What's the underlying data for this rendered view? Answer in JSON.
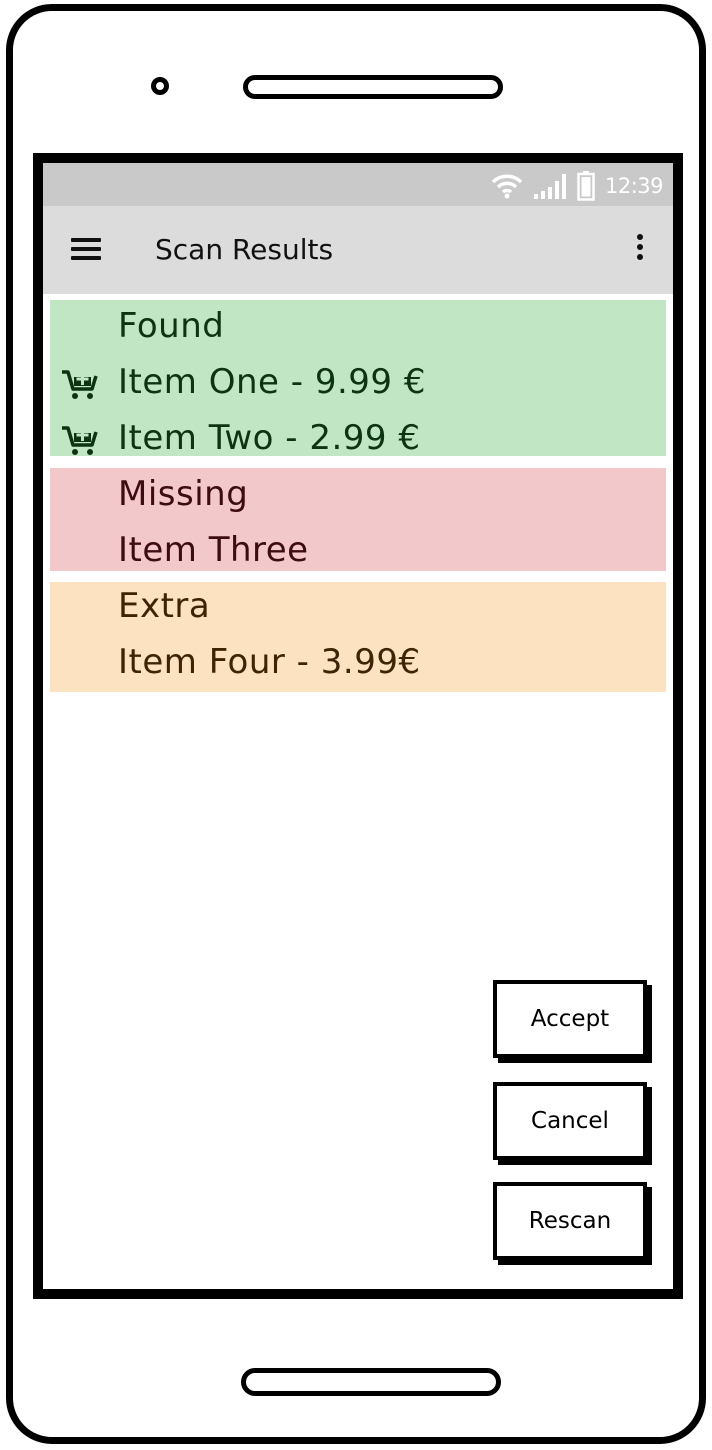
{
  "status_bar": {
    "time": "12:39",
    "icons": [
      "wifi-icon",
      "signal-icon",
      "battery-icon"
    ]
  },
  "app_bar": {
    "title": "Scan Results",
    "left_icon": "menu-icon",
    "right_icon": "overflow-menu-icon"
  },
  "sections": {
    "found": {
      "title": "Found",
      "color": "#c0e6c4",
      "items": [
        {
          "label": "Item One - 9.99 €",
          "icon": "add-to-cart-icon"
        },
        {
          "label": "Item Two - 2.99 €",
          "icon": "add-to-cart-icon"
        }
      ]
    },
    "missing": {
      "title": "Missing",
      "color": "#f2c8ca",
      "items": [
        {
          "label": "Item Three"
        }
      ]
    },
    "extra": {
      "title": "Extra",
      "color": "#fde2c1",
      "items": [
        {
          "label": "Item Four - 3.99€"
        }
      ]
    }
  },
  "actions": {
    "accept": "Accept",
    "cancel": "Cancel",
    "rescan": "Rescan"
  }
}
